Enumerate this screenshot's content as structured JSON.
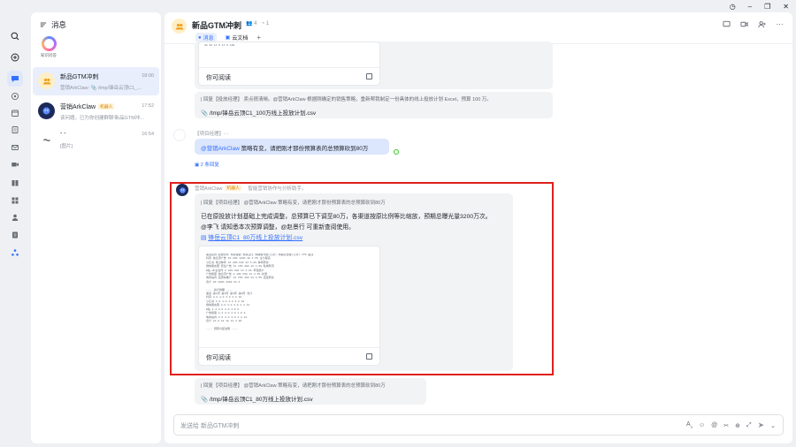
{
  "window": {
    "controls": [
      "history-icon",
      "minimize-icon",
      "restore-icon",
      "close-icon"
    ]
  },
  "rail": {
    "icons": [
      "search-icon",
      "add-icon",
      "chat-icon",
      "radar-icon",
      "calendar-icon",
      "doc-icon",
      "mail-icon",
      "video-icon",
      "book-icon",
      "apps-icon",
      "contacts-icon",
      "docs-icon",
      "org-icon"
    ]
  },
  "list": {
    "title": "消息",
    "agent_label": "知识问答",
    "conversations": [
      {
        "title": "新品GTM冲刺",
        "time": "18:00",
        "sub": "营销ArkClaw: 📎 /tmp/锋岳云顶C1_..."
      },
      {
        "title": "营销ArkClaw",
        "tag": "机器人",
        "time": "17:52",
        "sub": "该问题。已为你创建群聊'新品GTM冲..."
      },
      {
        "title": "- -",
        "time": "16:54",
        "sub": "[图片]"
      }
    ]
  },
  "chat": {
    "title": "新品GTM冲刺",
    "meta_members": "4",
    "meta_extra": "1",
    "tabs": [
      {
        "label": "消息",
        "active": true
      },
      {
        "label": "云文档",
        "active": false
      }
    ],
    "tab_add": "+",
    "input_placeholder": "发送给 新品GTM冲刺"
  },
  "messages": {
    "m1": {
      "card_footer": "你可阅读",
      "table_top_row": "30      30     17.5     17.5      100"
    },
    "m2": {
      "quote": "| 回复【投放经理】          卖点很清晰。@营销ArkClaw 根据刚确定的销售策略，重新帮我制定一份具体的线上投放计划 Excel，预算 100 万。",
      "file": "/tmp/锋岳云顶C1_100万线上投放计划.csv"
    },
    "m3": {
      "sender": "【项目经理】- -",
      "mention": "@营销ArkClaw",
      "text": "策略有变，请把刚才那份预算表的总预算砍到80万",
      "replies": "2 条回复"
    },
    "m4": {
      "sender": "营销ArkClaw",
      "tag": "机器人",
      "desc": "智能营销协作与分析助手。",
      "quote": "| 回复【项目经理】          @营销ArkClaw 策略有变，请把刚才那份预算表的总预算砍到80万",
      "line1": "已在原投放计划基础上完成调整，总预算已下调至80万，各渠道按原比例等比缩放，预期总曝光量3200万次。",
      "line2": "@李飞 请知悉本次预算调整，@赵景行 可重新查阅使用。",
      "file": "锋岳云顶C1_80万线上投放计划.csv",
      "card_footer": "你可阅读",
      "sheet_rows": [
        "渠道名称  投放形式  预算金额  预算占比  预期曝光量(万次) 预期点击量(万次)  CTR   备注",
        "抖音     信息流广告  16     20%     1200      30     2.5%  主力渠道",
        "小红书   笔记种草    16     20%      640      32     5.0%  种草转化",
        "微信朋友圈 原生广告   12     15%      400      16     4.0%  私域导流",
        "B站      UP主合作     8     10%      320      13     4.1%  年轻用户",
        "广告联盟  信息流广告  8     10%      560      14     2.5%  补量",
        "电商站内  直通车推广  12     15%      480      22     4.6%  直接转化",
        "合计            80    100%     3200     81.6",
        "",
        "---- 执行排期 ----",
        "渠道     第1周  第2周  第3周  第4周  合计",
        "抖音     4.8    4.0    4.0    3.2    16",
        "小红书   4.8    4.0    4.0    3.2    16",
        "微信朋友圈 3.6    3.0    3.0    2.4    12",
        "B站      2.4    2.0    2.0    1.6     8",
        "广告联盟  2.4    2.0    2.0    1.6     8",
        "电商站内  3.6    3.0    3.0    2.4    12",
        "合计     21.6   18     18     14.4    80",
        "",
        "---- 预算分配说明 ----"
      ]
    },
    "m5": {
      "quote": "| 回复【项目经理】          @营销ArkClaw 策略有变，请把刚才那份预算表的总预算砍到80万",
      "file": "/tmp/锋岳云顶C1_80万线上投放计划.csv"
    }
  }
}
